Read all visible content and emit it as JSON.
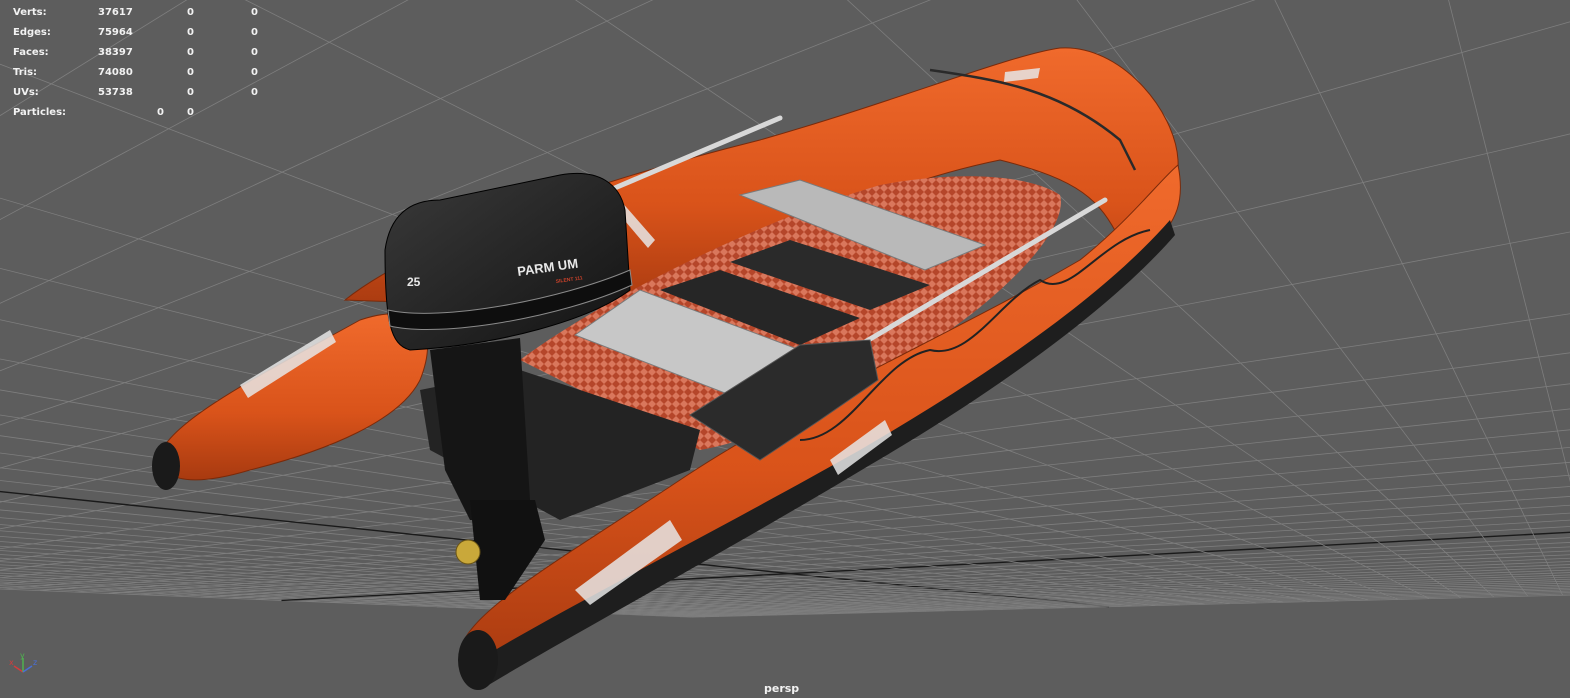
{
  "viewport": {
    "camera": "persp",
    "background_color": "#5d5d5d",
    "grid_color": "#7e7e7e",
    "grid_axis_color": "#1a1a1a"
  },
  "hud": {
    "rows": [
      {
        "label": "Verts:",
        "v1": "37617",
        "v2": "0",
        "v3": "0"
      },
      {
        "label": "Edges:",
        "v1": "75964",
        "v2": "0",
        "v3": "0"
      },
      {
        "label": "Faces:",
        "v1": "38397",
        "v2": "0",
        "v3": "0"
      },
      {
        "label": "Tris:",
        "v1": "74080",
        "v2": "0",
        "v3": "0"
      },
      {
        "label": "UVs:",
        "v1": "53738",
        "v2": "0",
        "v3": "0"
      }
    ],
    "particles": {
      "label": "Particles:",
      "v1": "0",
      "v2": "0"
    }
  },
  "model": {
    "name": "inflatable-boat",
    "hull_color": "#e0581d",
    "motor_color": "#1d1d1d",
    "motor_brand": "PARM UM",
    "motor_model_text": "SILENT 111",
    "motor_number": "25"
  },
  "axis_gizmo": {
    "x_label": "x",
    "y_label": "y",
    "z_label": "z",
    "x_color": "#d43c3c",
    "y_color": "#4fb34f",
    "z_color": "#4a6fd6"
  }
}
